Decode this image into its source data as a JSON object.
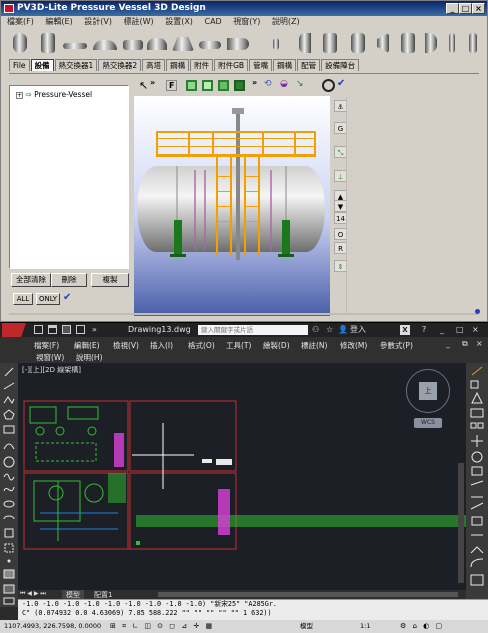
{
  "pv3d": {
    "title": "PV3D-Lite Pressure Vessel 3D Design",
    "menu": [
      "檔案(F)",
      "編輯(E)",
      "設計(V)",
      "標註(W)",
      "設置(X)",
      "CAD",
      "視窗(Y)",
      "說明(Z)"
    ],
    "tabs": [
      "File",
      "設備",
      "熱交換器1",
      "熱交換器2",
      "高塔",
      "鋼構",
      "附件",
      "附件GB",
      "管嘴",
      "鋼構",
      "配管",
      "設備陣台"
    ],
    "active_tab": "設備",
    "tree_root": "Pressure-Vessel",
    "buttons": {
      "clear_all": "全部清除",
      "delete": "刪除",
      "copy": "複製",
      "all": "ALL",
      "only": "ONLY"
    },
    "view_toolbar": [
      "F"
    ],
    "right_toolbar": [
      "G",
      "14",
      "O",
      "R"
    ]
  },
  "autocad": {
    "filename": "Drawing13.dwg",
    "search_placeholder": "鍵入關鍵字或片語",
    "login": "登入",
    "menu_row1": [
      "檔案(F)",
      "編輯(E)",
      "檢視(V)",
      "插入(I)",
      "格式(O)",
      "工具(T)",
      "繪製(D)",
      "標註(N)",
      "修改(M)",
      "參數式(P)"
    ],
    "menu_row2": [
      "視窗(W)",
      "說明(H)"
    ],
    "viewport_label": "[-][上][2D 線架構]",
    "wcs_label": "WCS",
    "compass": "上",
    "tabs": [
      "模型",
      "配置1"
    ],
    "command_line_1": "-1.0 -1.0 -1.0 -1.0 -1.0 -1.0 -1.0 -1.0 -1.0) \"新宋25\" \"A285Gr.",
    "command_line_2": "C\" (0.074932 0.0 4.63069) 7.85 588.222 \"\" \"\" \"\" \"\" \"\" 1 632))",
    "status_coords": "1107.4993, 226.7598, 0.0000",
    "status_model": "模型",
    "status_scale": "1:1"
  }
}
